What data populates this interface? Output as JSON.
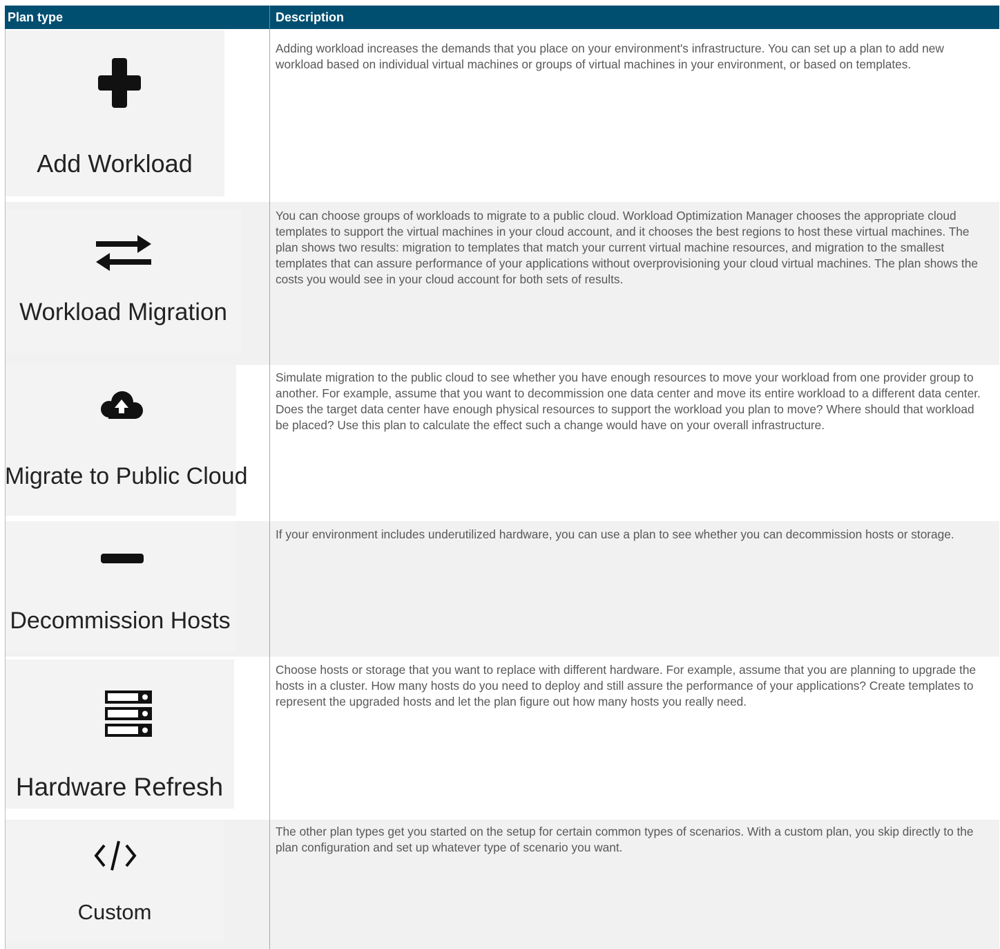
{
  "table": {
    "headers": [
      "Plan type",
      "Description"
    ],
    "rows": [
      {
        "label": "Add Workload",
        "icon": "plus-icon",
        "description": "Adding workload increases the demands that you place on your environment's infrastructure. You can set up a plan to add new workload based on individual virtual machines or groups of virtual machines in your environment, or based on templates."
      },
      {
        "label": "Workload Migration",
        "icon": "swap-arrows-icon",
        "description": "You can choose groups of workloads to migrate to a public cloud. Workload Optimization Manager chooses the appropriate cloud templates to support the virtual machines in your cloud account, and it chooses the best regions to host these virtual machines. The plan shows two results: migration to templates that match your current virtual machine resources, and migration to the smallest templates that can assure performance of your applications without overprovisioning your cloud virtual machines. The plan shows the costs you would see in your cloud account for both sets of results."
      },
      {
        "label": "Migrate to Public Cloud",
        "icon": "cloud-upload-icon",
        "description": "Simulate migration to the public cloud to see whether you have enough resources to move your workload from one provider group to another. For example, assume that you want to decommission one data center and move its entire workload to a different data center. Does the target data center have enough physical resources to support the workload you plan to move? Where should that workload be placed? Use this plan to calculate the effect such a change would have on your overall infrastructure."
      },
      {
        "label": "Decommission Hosts",
        "icon": "minus-icon",
        "description": "If your environment includes underutilized hardware, you can use a plan to see whether you can decommission hosts or storage."
      },
      {
        "label": "Hardware Refresh",
        "icon": "server-stack-icon",
        "description": "Choose hosts or storage that you want to replace with different hardware. For example, assume that you are planning to upgrade the hosts in a cluster. How many hosts do you need to deploy and still assure the performance of your applications? Create templates to represent the upgraded hosts and let the plan figure out how many hosts you really need."
      },
      {
        "label": "Custom",
        "icon": "code-icon",
        "description": "The other plan types get you started on the setup for certain common types of scenarios. With a custom plan, you skip directly to the plan configuration and set up whatever type of scenario you want."
      }
    ]
  }
}
